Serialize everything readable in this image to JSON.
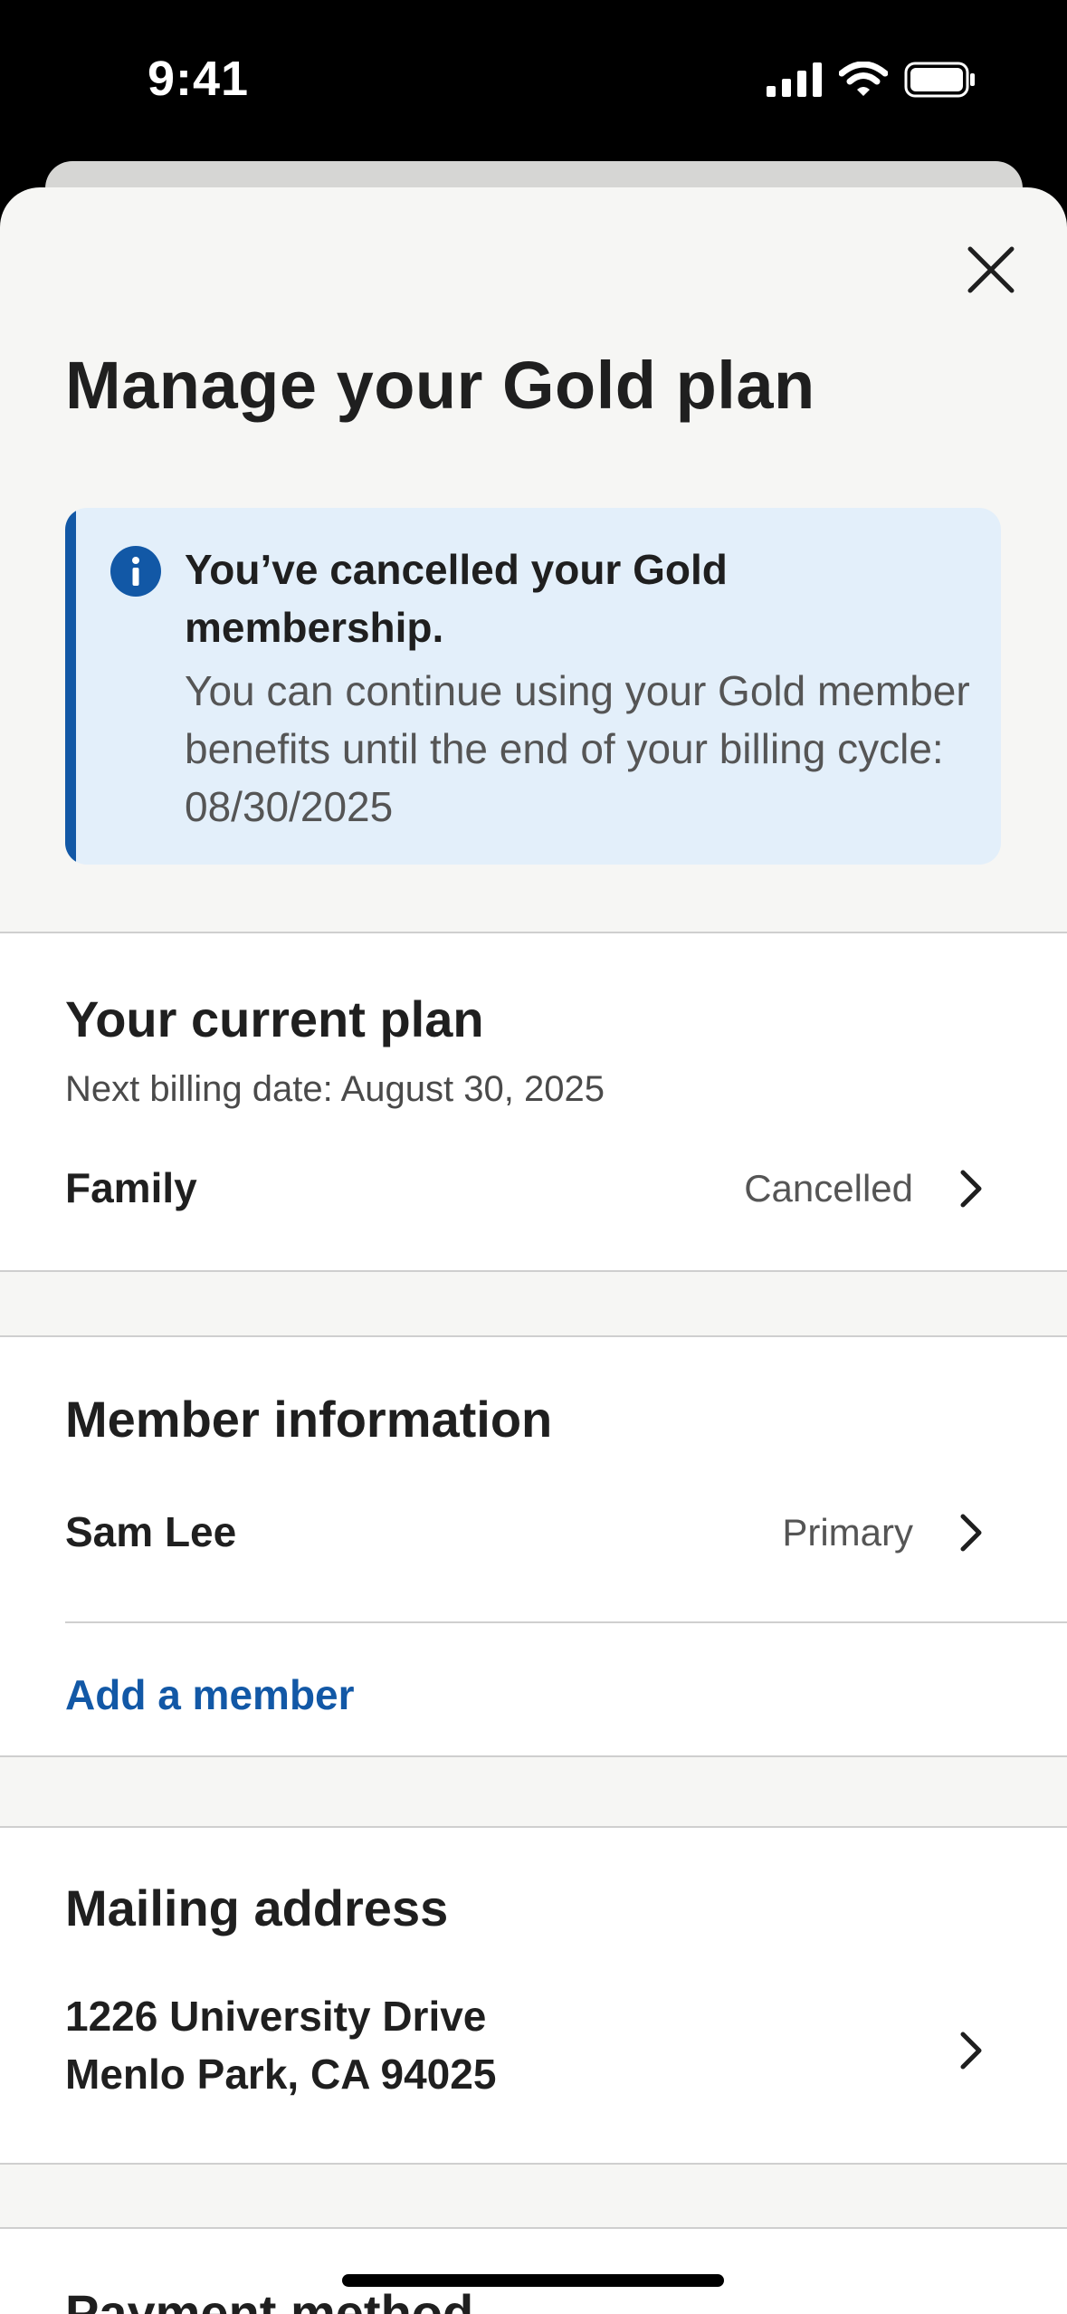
{
  "status_bar": {
    "time": "9:41"
  },
  "sheet": {
    "title": "Manage your Gold plan",
    "banner": {
      "title": "You’ve cancelled your Gold membership.",
      "body": "You can continue using your Gold member benefits until the end of your billing cycle: 08/30/2025"
    },
    "current_plan": {
      "title": "Your current plan",
      "next_billing": "Next billing date: August 30, 2025",
      "plan_name": "Family",
      "status": "Cancelled"
    },
    "member_information": {
      "title": "Member information",
      "member_name": "Sam Lee",
      "member_role": "Primary",
      "add_member": "Add a member"
    },
    "mailing_address": {
      "title": "Mailing address",
      "line1": "1226 University Drive",
      "line2": "Menlo Park, CA 94025"
    },
    "payment_method": {
      "title": "Payment method"
    }
  },
  "colors": {
    "accent": "#1258a6",
    "banner_bg": "#e3effa",
    "sheet_bg": "#f6f6f4"
  },
  "icons": [
    "cellular-signal-icon",
    "wifi-icon",
    "battery-icon",
    "close-icon",
    "info-icon",
    "chevron-right-icon"
  ]
}
